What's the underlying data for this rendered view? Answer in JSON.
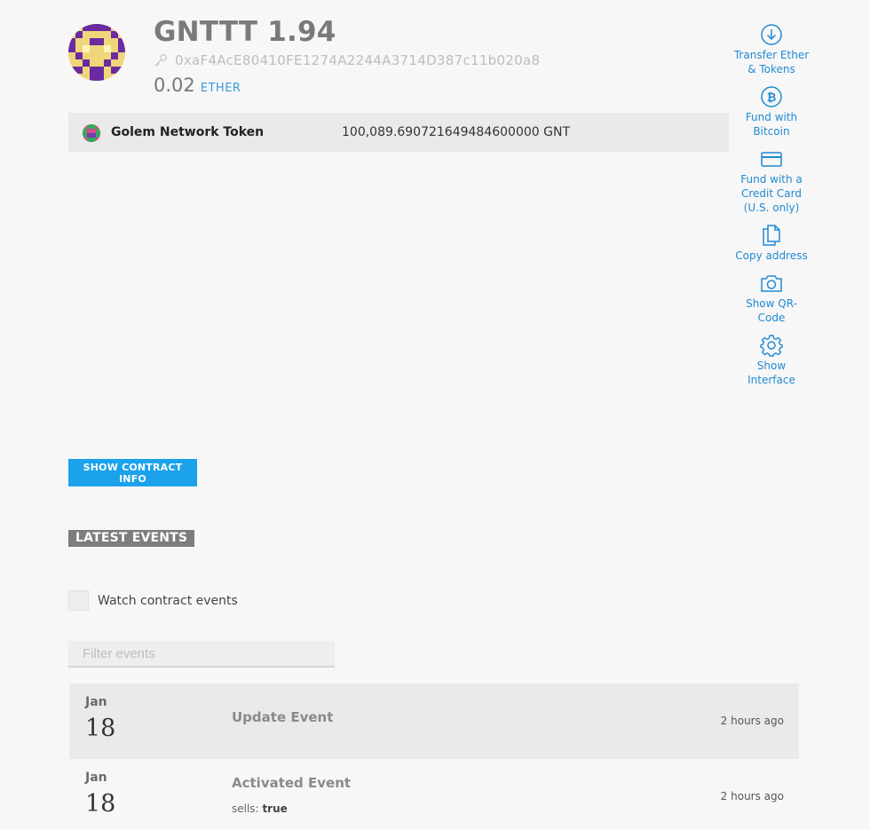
{
  "header": {
    "title": "GNTTT 1.94",
    "address": "0xaF4AcE80410FE1274A2244A3714D387c11b020a8",
    "balance": "0.02",
    "balance_unit": "ETHER"
  },
  "token": {
    "name": "Golem Network Token",
    "balance": "100,089.690721649484600000 GNT"
  },
  "actions": [
    {
      "label": "Transfer Ether & Tokens",
      "icon": "arrow-down-circle-icon"
    },
    {
      "label": "Fund with Bitcoin",
      "icon": "bitcoin-icon"
    },
    {
      "label": "Fund with a Credit Card (U.S. only)",
      "icon": "credit-card-icon"
    },
    {
      "label": "Copy address",
      "icon": "copy-icon"
    },
    {
      "label": "Show QR-Code",
      "icon": "camera-icon"
    },
    {
      "label": "Show Interface",
      "icon": "gear-icon"
    }
  ],
  "contract": {
    "show_info_label": "SHOW CONTRACT INFO"
  },
  "events": {
    "heading": "LATEST EVENTS",
    "watch_label": "Watch contract events",
    "filter_placeholder": "Filter events",
    "items": [
      {
        "month": "Jan",
        "day": "18",
        "name": "Update Event",
        "time": "2 hours ago"
      },
      {
        "month": "Jan",
        "day": "18",
        "name": "Activated Event",
        "time": "2 hours ago",
        "param_key": "sells:",
        "param_value": "true"
      }
    ]
  },
  "colors": {
    "accent": "#1ba2eb",
    "link": "#1f8ad2",
    "heading_bg": "#7f7c7c",
    "row_bg": "#ebe9e9"
  }
}
